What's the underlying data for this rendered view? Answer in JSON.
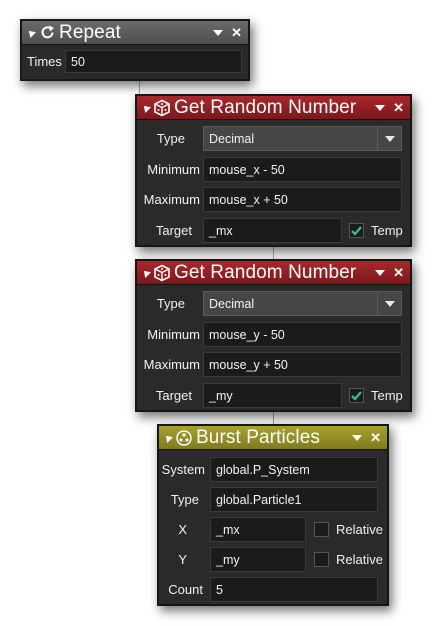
{
  "colors": {
    "repeat_header": "#5c5c5c",
    "random_header": "#8f1f23",
    "particles_header": "#948e2b",
    "panel_bg": "#2a2a2a",
    "checkbox_check": "#3fb39a"
  },
  "repeat": {
    "title": "Repeat",
    "icon": "repeat-icon",
    "times_label": "Times",
    "times_value": "50"
  },
  "random1": {
    "title": "Get Random Number",
    "icon": "dice-icon",
    "type_label": "Type",
    "type_value": "Decimal",
    "min_label": "Minimum",
    "min_value": "mouse_x - 50",
    "max_label": "Maximum",
    "max_value": "mouse_x + 50",
    "target_label": "Target",
    "target_value": "_mx",
    "temp_label": "Temp",
    "temp_checked": true
  },
  "random2": {
    "title": "Get Random Number",
    "icon": "dice-icon",
    "type_label": "Type",
    "type_value": "Decimal",
    "min_label": "Minimum",
    "min_value": "mouse_y - 50",
    "max_label": "Maximum",
    "max_value": "mouse_y + 50",
    "target_label": "Target",
    "target_value": "_my",
    "temp_label": "Temp",
    "temp_checked": true
  },
  "burst": {
    "title": "Burst Particles",
    "icon": "particles-icon",
    "system_label": "System",
    "system_value": "global.P_System",
    "type_label": "Type",
    "type_value": "global.Particle1",
    "x_label": "X",
    "x_value": "_mx",
    "x_relative_label": "Relative",
    "x_relative_checked": false,
    "y_label": "Y",
    "y_value": "_my",
    "y_relative_label": "Relative",
    "y_relative_checked": false,
    "count_label": "Count",
    "count_value": "5"
  }
}
